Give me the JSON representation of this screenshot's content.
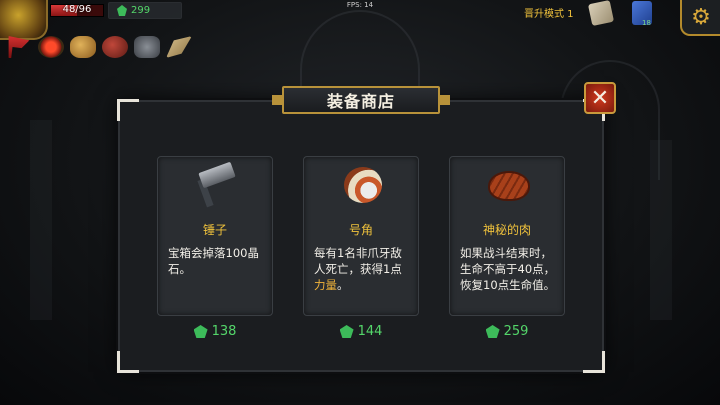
{
  "hud": {
    "hp": "48/96",
    "hp_fraction": 0.5,
    "gems": "299",
    "fps": "FPS: 14",
    "mode": "晋升模式 1",
    "book_count": "18"
  },
  "relics": [
    {
      "icon": "red-flag-icon"
    },
    {
      "icon": "red-gem-icon"
    },
    {
      "icon": "gold-pot-icon"
    },
    {
      "icon": "red-bag-icon"
    },
    {
      "icon": "beetle-icon"
    },
    {
      "icon": "scroll-icon"
    }
  ],
  "shop": {
    "title": "装备商店",
    "items": [
      {
        "name": "锤子",
        "icon": "hammer-icon",
        "desc": "宝箱会掉落100晶石。",
        "price": "138"
      },
      {
        "name": "号角",
        "icon": "horn-icon",
        "desc_pre": "每有1名非爪牙敌人死亡，获得1点",
        "desc_highlight": "力量",
        "desc_post": "。",
        "price": "144"
      },
      {
        "name": "神秘的肉",
        "icon": "meat-icon",
        "desc": "如果战斗结束时，生命不高于40点，恢复10点生命值。",
        "price": "259"
      }
    ]
  },
  "colors": {
    "gold": "#f0c23c",
    "gem_green": "#54d66a",
    "close_red": "#d23a1e"
  }
}
